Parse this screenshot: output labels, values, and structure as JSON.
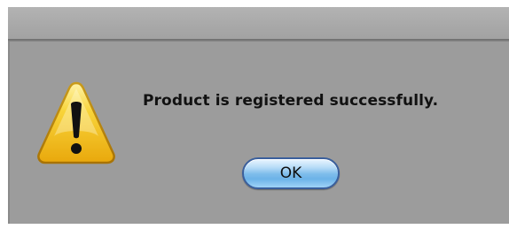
{
  "dialog": {
    "message": "Product is registered successfully.",
    "icon": "warning-icon",
    "ok_label": "OK",
    "colors": {
      "background": "#9c9c9c",
      "icon_yellow": "#f5c518",
      "button_blue": "#7fbdeb"
    }
  }
}
